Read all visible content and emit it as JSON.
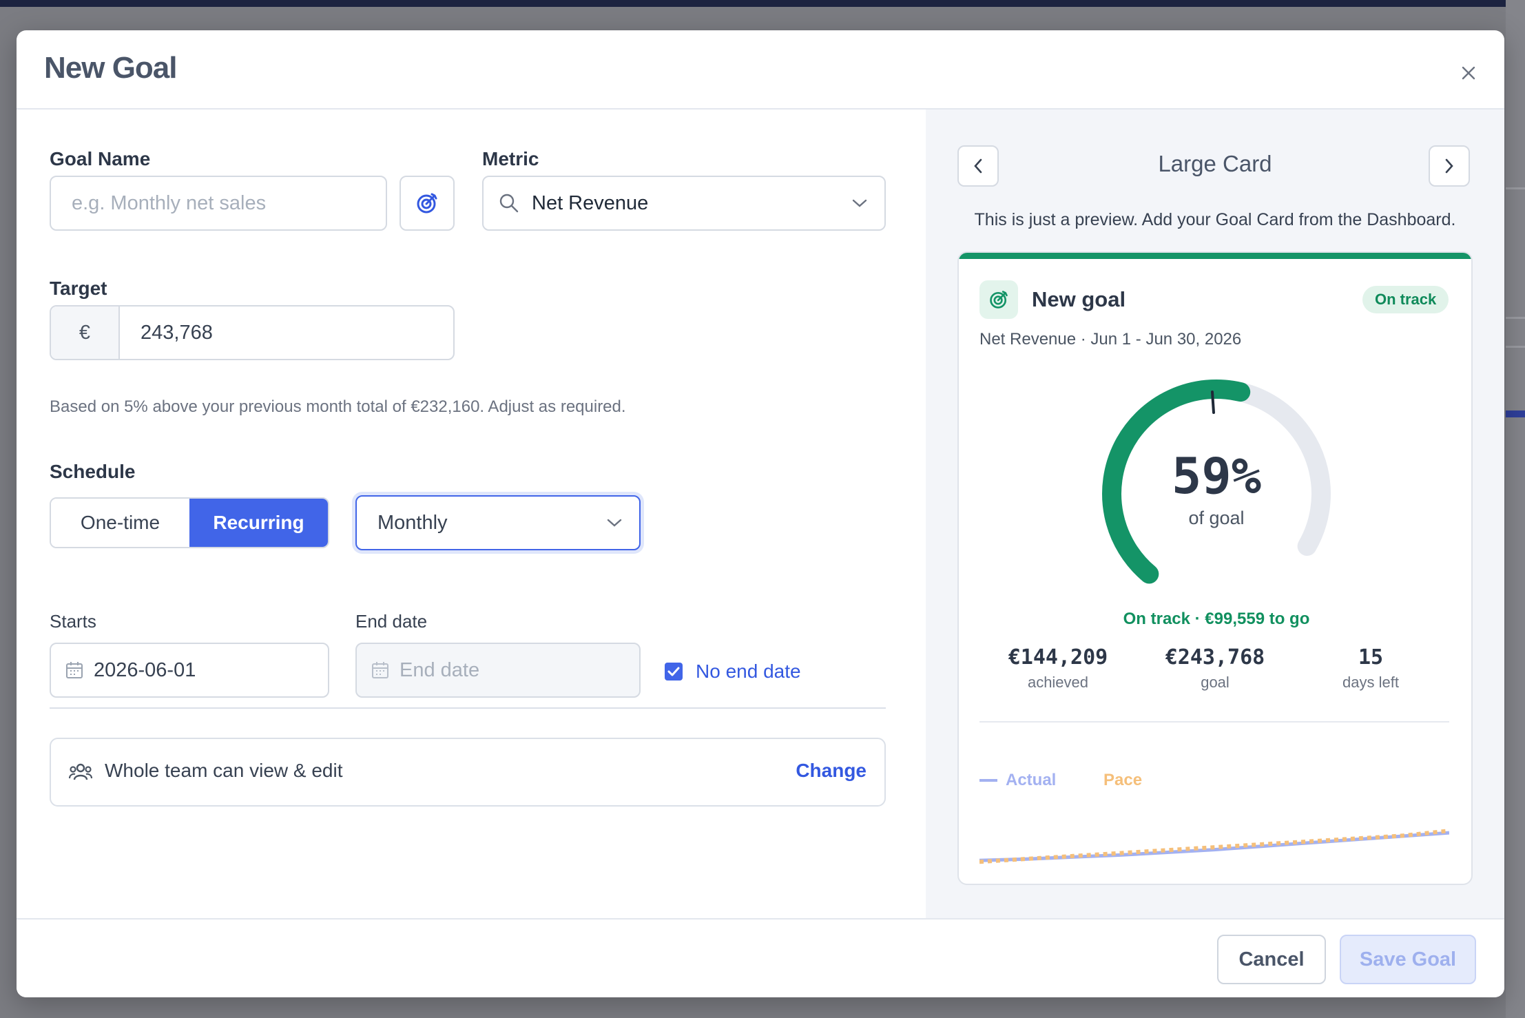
{
  "modal": {
    "title": "New Goal"
  },
  "form": {
    "goal_name": {
      "label": "Goal Name",
      "placeholder": "e.g. Monthly net sales"
    },
    "metric": {
      "label": "Metric",
      "value": "Net Revenue"
    },
    "target": {
      "label": "Target",
      "currency": "€",
      "value": "243,768",
      "hint": "Based on 5% above your previous month total of €232,160. Adjust as required."
    },
    "schedule": {
      "label": "Schedule",
      "options": [
        "One-time",
        "Recurring"
      ],
      "selected": "Recurring",
      "frequency": "Monthly"
    },
    "starts": {
      "label": "Starts",
      "value": "2026-06-01"
    },
    "end_date": {
      "label": "End date",
      "placeholder": "End date"
    },
    "no_end_date": {
      "label": "No end date",
      "checked": true
    },
    "sharing": {
      "text": "Whole team can view & edit",
      "action": "Change"
    }
  },
  "preview": {
    "title": "Large Card",
    "note": "This is just a preview. Add your Goal Card from the Dashboard.",
    "card": {
      "title": "New goal",
      "badge": "On track",
      "subtitle": "Net Revenue · Jun 1 - Jun 30, 2026",
      "percent_label": "59%",
      "percent": 59,
      "percent_caption": "of goal",
      "status_line": "On track · €99,559 to go",
      "stats": [
        {
          "value": "€144,209",
          "label": "achieved"
        },
        {
          "value": "€243,768",
          "label": "goal"
        },
        {
          "value": "15",
          "label": "days left"
        }
      ]
    }
  },
  "chart_data": {
    "type": "line",
    "series": [
      {
        "name": "Actual",
        "color": "#a3b1f1",
        "values": [
          12,
          14,
          17,
          20,
          24,
          28,
          33,
          38,
          43,
          48,
          53
        ]
      },
      {
        "name": "Pace",
        "color": "#f5bf7a",
        "values": [
          10,
          14.3,
          18.6,
          22.9,
          27.2,
          31.5,
          35.8,
          40.1,
          44.4,
          48.7,
          56
        ]
      }
    ],
    "ylim": [
      0,
      100
    ]
  },
  "footer": {
    "cancel": "Cancel",
    "save": "Save Goal"
  },
  "colors": {
    "primary": "#4165e8",
    "success": "#149467",
    "gauge_track": "#e6e9ef"
  }
}
